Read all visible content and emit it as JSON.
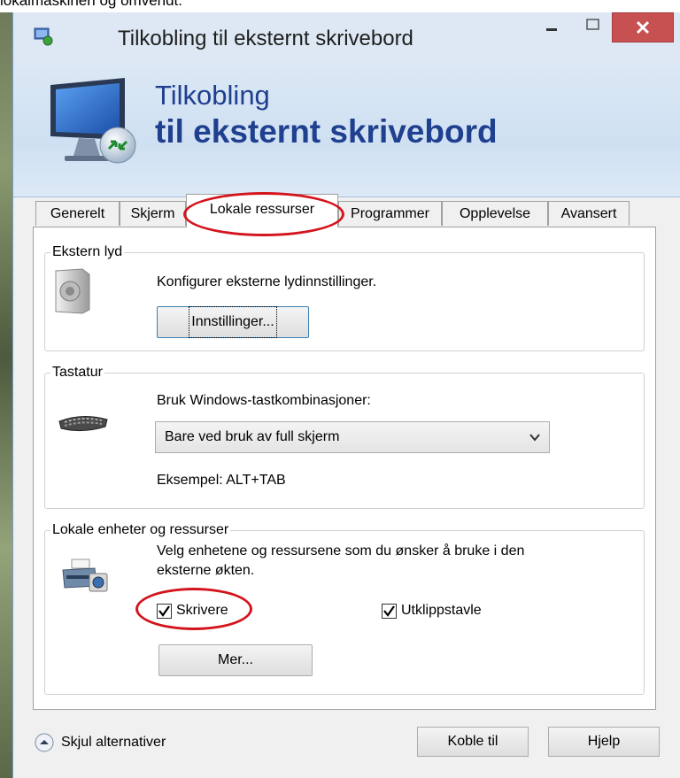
{
  "caption": "lokalmaskinen og omvendt.",
  "window": {
    "title": "Tilkobling til eksternt skrivebord",
    "close_glyph": "✕"
  },
  "banner": {
    "line1": "Tilkobling",
    "line2": "til eksternt skrivebord"
  },
  "tabs": [
    {
      "label": "Generelt"
    },
    {
      "label": "Skjerm"
    },
    {
      "label": "Lokale ressurser",
      "active": true
    },
    {
      "label": "Programmer"
    },
    {
      "label": "Opplevelse"
    },
    {
      "label": "Avansert"
    }
  ],
  "sound": {
    "title": "Ekstern lyd",
    "description": "Konfigurer eksterne lydinnstillinger.",
    "settings_button": "Innstillinger..."
  },
  "keyboard": {
    "title": "Tastatur",
    "description": "Bruk Windows-tastkombinasjoner:",
    "selected_option": "Bare ved bruk av full skjerm",
    "example": "Eksempel: ALT+TAB"
  },
  "devices": {
    "title": "Lokale enheter og ressurser",
    "description_line1": "Velg enhetene og ressursene som du ønsker å bruke i den",
    "description_line2": "eksterne økten.",
    "printers_label": "Skrivere",
    "printers_checked": true,
    "clipboard_label": "Utklippstavle",
    "clipboard_checked": true,
    "more_button": "Mer..."
  },
  "footer": {
    "hide_options": "Skjul alternativer",
    "connect_button": "Koble til",
    "help_button": "Hjelp"
  },
  "colors": {
    "banner_text": "#1f3f8f",
    "annotation_red": "#d4141c",
    "close_button": "#c75050"
  },
  "icons": [
    "remote-desktop-icon",
    "speaker-icon",
    "keyboard-icon",
    "printer-camera-icon",
    "collapse-arrow-icon"
  ]
}
